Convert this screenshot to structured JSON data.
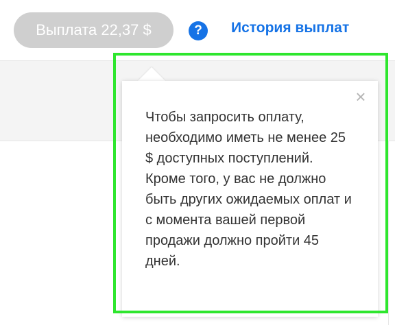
{
  "header": {
    "payout_button_label": "Выплата 22,37 $",
    "help_icon_glyph": "?",
    "history_link_label": "История выплат"
  },
  "tooltip": {
    "close_glyph": "×",
    "message": "Чтобы запросить оплату, необходимо иметь не менее 25 $ доступных поступлений. Кроме того, у вас не должно быть других ожидаемых оплат и с момента вашей первой продажи должно пройти 45 дней."
  },
  "icons": {
    "help": "question-circle-icon",
    "close": "close-icon"
  },
  "colors": {
    "accent": "#1673e6",
    "button_disabled_bg": "#cfcfcf",
    "highlight": "#2ee62e"
  }
}
